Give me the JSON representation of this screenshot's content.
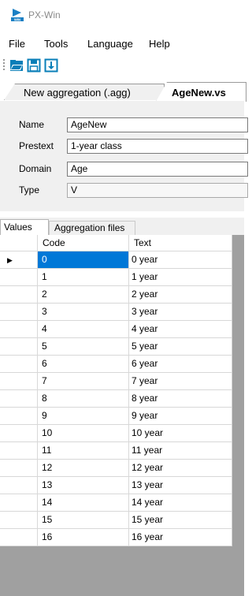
{
  "window": {
    "title": "PX-Win"
  },
  "menu": [
    "File",
    "Tools",
    "Language",
    "Help"
  ],
  "toolbar": [
    "open-folder-icon",
    "save-icon",
    "import-icon"
  ],
  "doc_tabs": [
    {
      "label": "New aggregation (.agg)",
      "active": false
    },
    {
      "label": "AgeNew.vs",
      "active": true
    }
  ],
  "properties": {
    "name": {
      "label": "Name",
      "value": "AgeNew"
    },
    "prestext": {
      "label": "Prestext",
      "value": "1-year class"
    },
    "domain": {
      "label": "Domain",
      "value": "Age"
    },
    "type": {
      "label": "Type",
      "value": "V"
    }
  },
  "lower_tabs": [
    "Values",
    "Aggregation files"
  ],
  "grid": {
    "columns": [
      "Code",
      "Text"
    ],
    "selected_row": 0,
    "rows": [
      [
        "0",
        "0 year"
      ],
      [
        "1",
        "1 year"
      ],
      [
        "2",
        "2 year"
      ],
      [
        "3",
        "3 year"
      ],
      [
        "4",
        "4 year"
      ],
      [
        "5",
        "5 year"
      ],
      [
        "6",
        "6 year"
      ],
      [
        "7",
        "7 year"
      ],
      [
        "8",
        "8 year"
      ],
      [
        "9",
        "9 year"
      ],
      [
        "10",
        "10 year"
      ],
      [
        "11",
        "11 year"
      ],
      [
        "12",
        "12 year"
      ],
      [
        "13",
        "13 year"
      ],
      [
        "14",
        "14 year"
      ],
      [
        "15",
        "15 year"
      ],
      [
        "16",
        "16 year"
      ]
    ]
  },
  "colors": {
    "selection": "#0078d7",
    "toolbar_icon": "#0a7fb8",
    "grid_background": "#a0a0a0"
  }
}
